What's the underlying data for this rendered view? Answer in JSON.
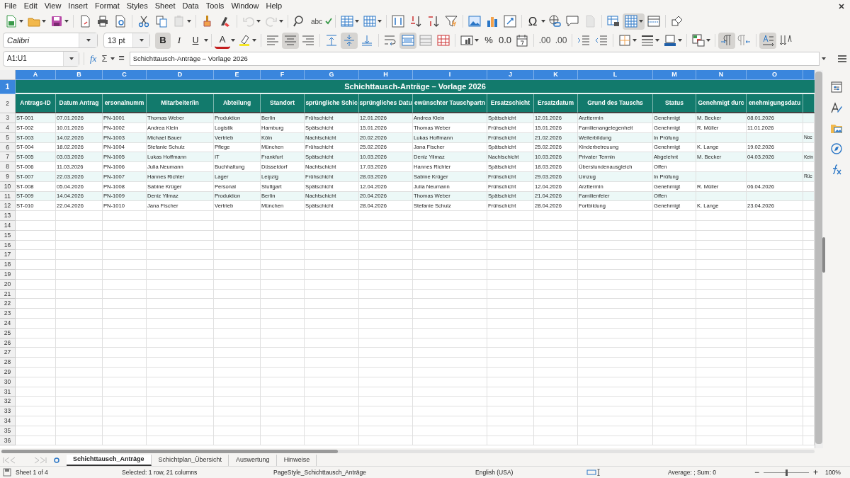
{
  "menu": [
    "File",
    "Edit",
    "View",
    "Insert",
    "Format",
    "Styles",
    "Sheet",
    "Data",
    "Tools",
    "Window",
    "Help"
  ],
  "standard_toolbar": [
    {
      "kind": "new"
    },
    {
      "kind": "open"
    },
    {
      "kind": "save"
    },
    {
      "kind": "sep"
    },
    {
      "kind": "pdf"
    },
    {
      "kind": "print"
    },
    {
      "kind": "preview"
    },
    {
      "kind": "sep"
    },
    {
      "kind": "cut"
    },
    {
      "kind": "copy"
    },
    {
      "kind": "paste",
      "disabled": true
    },
    {
      "kind": "sep"
    },
    {
      "kind": "brush"
    },
    {
      "kind": "clear"
    },
    {
      "kind": "sep"
    },
    {
      "kind": "undo",
      "disabled": true
    },
    {
      "kind": "redo",
      "disabled": true
    },
    {
      "kind": "sep"
    },
    {
      "kind": "find"
    },
    {
      "kind": "spell",
      "label": "abc"
    },
    {
      "kind": "sep"
    },
    {
      "kind": "rows"
    },
    {
      "kind": "cols"
    },
    {
      "kind": "sep"
    },
    {
      "kind": "sort"
    },
    {
      "kind": "sortasc"
    },
    {
      "kind": "sortdesc"
    },
    {
      "kind": "filter"
    },
    {
      "kind": "sep"
    },
    {
      "kind": "image"
    },
    {
      "kind": "chart"
    },
    {
      "kind": "pivot"
    },
    {
      "kind": "sep"
    },
    {
      "kind": "special",
      "label": "Ω"
    },
    {
      "kind": "link"
    },
    {
      "kind": "comment"
    },
    {
      "kind": "page",
      "disabled": true
    },
    {
      "kind": "sep"
    },
    {
      "kind": "printrange"
    },
    {
      "kind": "freeze",
      "pressed": true
    },
    {
      "kind": "split"
    },
    {
      "kind": "sep"
    },
    {
      "kind": "shapes"
    }
  ],
  "font_name": "Calibri",
  "font_size": "13 pt",
  "formatting_toolbar": [
    {
      "kind": "bold",
      "label": "B",
      "pressed": true
    },
    {
      "kind": "italic",
      "label": "I",
      "pressed": false
    },
    {
      "kind": "underline",
      "label": "U",
      "pressed": false
    },
    {
      "kind": "sep"
    },
    {
      "kind": "fontcolor",
      "label": "A",
      "pressed": false
    },
    {
      "kind": "highlight",
      "pressed": false
    },
    {
      "kind": "sep"
    },
    {
      "kind": "alignleft",
      "pressed": false
    },
    {
      "kind": "aligncenter",
      "pressed": true
    },
    {
      "kind": "alignright",
      "pressed": false
    },
    {
      "kind": "sep"
    },
    {
      "kind": "valigntop",
      "pressed": false
    },
    {
      "kind": "valignmid",
      "pressed": true
    },
    {
      "kind": "valignbottom",
      "pressed": false
    },
    {
      "kind": "sep"
    },
    {
      "kind": "wrap",
      "pressed": false
    },
    {
      "kind": "merge",
      "pressed": true
    },
    {
      "kind": "mergecells",
      "pressed": false
    },
    {
      "kind": "unmerge",
      "pressed": false
    },
    {
      "kind": "sep"
    },
    {
      "kind": "numformat",
      "pressed": false
    },
    {
      "kind": "percent",
      "label": "%",
      "pressed": false
    },
    {
      "kind": "decimal",
      "label": "0.0",
      "pressed": false
    },
    {
      "kind": "date",
      "pressed": false
    },
    {
      "kind": "sep"
    },
    {
      "kind": "adddec",
      "label": ".00",
      "pressed": false
    },
    {
      "kind": "deldec",
      "label": ".00",
      "pressed": false
    },
    {
      "kind": "sep"
    },
    {
      "kind": "indent",
      "pressed": false
    },
    {
      "kind": "outdent",
      "pressed": false
    },
    {
      "kind": "sep"
    },
    {
      "kind": "borders",
      "pressed": false
    },
    {
      "kind": "borderstyle",
      "pressed": false
    },
    {
      "kind": "bordercolor",
      "pressed": false
    },
    {
      "kind": "sep"
    },
    {
      "kind": "conditional",
      "pressed": false
    },
    {
      "kind": "sep"
    },
    {
      "kind": "ltr",
      "pressed": true
    },
    {
      "kind": "rtl",
      "pressed": false
    },
    {
      "kind": "sep"
    },
    {
      "kind": "textdir",
      "pressed": true
    },
    {
      "kind": "vertical",
      "pressed": false
    }
  ],
  "name_box": "A1:U1",
  "formula_buttons": [
    "fx",
    "Σ",
    "="
  ],
  "formula": "Schichttausch-Anträge – Vorlage 2026",
  "sheet": {
    "column_headers": [
      {
        "label": "A",
        "selected": true
      },
      {
        "label": "B",
        "selected": true
      },
      {
        "label": "C",
        "selected": true
      },
      {
        "label": "D",
        "selected": true
      },
      {
        "label": "E",
        "selected": true
      },
      {
        "label": "F",
        "selected": true
      },
      {
        "label": "G",
        "selected": true
      },
      {
        "label": "H",
        "selected": true
      },
      {
        "label": "I",
        "selected": true
      },
      {
        "label": "J",
        "selected": true
      },
      {
        "label": "K",
        "selected": true
      },
      {
        "label": "L",
        "selected": true
      },
      {
        "label": "M",
        "selected": true
      },
      {
        "label": "N",
        "selected": true
      },
      {
        "label": "O",
        "selected": true
      },
      {
        "selected": true
      }
    ],
    "row_headers": [
      {
        "label": "1",
        "selected": true
      },
      {
        "label": "2",
        "selected": false
      },
      {
        "label": "3",
        "selected": false
      },
      {
        "label": "4",
        "selected": false
      },
      {
        "label": "5",
        "selected": false
      },
      {
        "label": "6",
        "selected": false
      },
      {
        "label": "7",
        "selected": false
      },
      {
        "label": "8",
        "selected": false
      },
      {
        "label": "9",
        "selected": false
      },
      {
        "label": "10",
        "selected": false
      },
      {
        "label": "11",
        "selected": false
      },
      {
        "label": "12",
        "selected": false
      },
      {
        "label": "13",
        "selected": false
      },
      {
        "label": "14",
        "selected": false
      },
      {
        "label": "15",
        "selected": false
      },
      {
        "label": "16",
        "selected": false
      },
      {
        "label": "17",
        "selected": false
      },
      {
        "label": "18",
        "selected": false
      },
      {
        "label": "19",
        "selected": false
      },
      {
        "label": "20",
        "selected": false
      },
      {
        "label": "21",
        "selected": false
      },
      {
        "label": "22",
        "selected": false
      },
      {
        "label": "23",
        "selected": false
      },
      {
        "label": "24",
        "selected": false
      },
      {
        "label": "25",
        "selected": false
      },
      {
        "label": "26",
        "selected": false
      },
      {
        "label": "27",
        "selected": false
      },
      {
        "label": "28",
        "selected": false
      },
      {
        "label": "29",
        "selected": false
      },
      {
        "label": "30",
        "selected": false
      },
      {
        "label": "31",
        "selected": false
      },
      {
        "label": "32",
        "selected": false
      },
      {
        "label": "33",
        "selected": false
      },
      {
        "label": "34",
        "selected": false
      },
      {
        "label": "35",
        "selected": false
      },
      {
        "label": "36",
        "selected": false
      }
    ],
    "title": "Schichttausch-Anträge – Vorlage 2026",
    "headers": [
      "Antrags-ID",
      "Datum Antrag",
      "ersonalnumm",
      "Mitarbeiter/in",
      "Abteilung",
      "Standort",
      "sprüngliche Schic",
      "sprüngliches Datu",
      "ewünschter Tauschpartn",
      "Ersatzschicht",
      "Ersatzdatum",
      "Grund des Tauschs",
      "Status",
      "Genehmigt durc",
      "enehmigungsdatu"
    ],
    "rows": [
      [
        "ST-001",
        "07.01.2026",
        "PN-1001",
        "Thomas Weber",
        "Produktion",
        "Berlin",
        "Frühschicht",
        "12.01.2026",
        "Andrea Klein",
        "Spätschicht",
        "12.01.2026",
        "Arzttermin",
        "Genehmigt",
        "M. Becker",
        "08.01.2026"
      ],
      [
        "ST-002",
        "10.01.2026",
        "PN-1002",
        "Andrea Klein",
        "Logistik",
        "Hamburg",
        "Spätschicht",
        "15.01.2026",
        "Thomas Weber",
        "Frühschicht",
        "15.01.2026",
        "Familienangelegenheit",
        "Genehmigt",
        "R. Müller",
        "11.01.2026"
      ],
      [
        "ST-003",
        "14.02.2026",
        "PN-1003",
        "Michael Bauer",
        "Vertrieb",
        "Köln",
        "Nachtschicht",
        "20.02.2026",
        "Lukas Hoffmann",
        "Frühschicht",
        "21.02.2026",
        "Weiterbildung",
        "In Prüfung",
        null,
        null,
        "Noc"
      ],
      [
        "ST-004",
        "18.02.2026",
        "PN-1004",
        "Stefanie Schulz",
        "Pflege",
        "München",
        "Frühschicht",
        "25.02.2026",
        "Jana Fischer",
        "Spätschicht",
        "25.02.2026",
        "Kinderbetreuung",
        "Genehmigt",
        "K. Lange",
        "19.02.2026"
      ],
      [
        "ST-005",
        "03.03.2026",
        "PN-1005",
        "Lukas Hoffmann",
        "IT",
        "Frankfurt",
        "Spätschicht",
        "10.03.2026",
        "Deniz Yilmaz",
        "Nachtschicht",
        "10.03.2026",
        "Privater Termin",
        "Abgelehnt",
        "M. Becker",
        "04.03.2026",
        "Kein"
      ],
      [
        "ST-006",
        "11.03.2026",
        "PN-1006",
        "Julia Neumann",
        "Buchhaltung",
        "Düsseldorf",
        "Nachtschicht",
        "17.03.2026",
        "Hannes Richter",
        "Spätschicht",
        "18.03.2026",
        "Überstundenausgleich",
        "Offen"
      ],
      [
        "ST-007",
        "22.03.2026",
        "PN-1007",
        "Hannes Richter",
        "Lager",
        "Leipzig",
        "Frühschicht",
        "28.03.2026",
        "Sabine Krüger",
        "Frühschicht",
        "29.03.2026",
        "Umzug",
        "In Prüfung",
        null,
        null,
        "Rüc"
      ],
      [
        "ST-008",
        "05.04.2026",
        "PN-1008",
        "Sabine Krüger",
        "Personal",
        "Stuttgart",
        "Spätschicht",
        "12.04.2026",
        "Julia Neumann",
        "Frühschicht",
        "12.04.2026",
        "Arzttermin",
        "Genehmigt",
        "R. Müller",
        "06.04.2026"
      ],
      [
        "ST-009",
        "14.04.2026",
        "PN-1009",
        "Deniz Yilmaz",
        "Produktion",
        "Berlin",
        "Nachtschicht",
        "20.04.2026",
        "Thomas Weber",
        "Spätschicht",
        "21.04.2026",
        "Familienfeier",
        "Offen"
      ],
      [
        "ST-010",
        "22.04.2026",
        "PN-1010",
        "Jana Fischer",
        "Vertrieb",
        "München",
        "Spätschicht",
        "28.04.2026",
        "Stefanie Schulz",
        "Frühschicht",
        "28.04.2026",
        "Fortbildung",
        "Genehmigt",
        "K. Lange",
        "23.04.2026"
      ]
    ]
  },
  "sheet_tabs": [
    {
      "label": "Schichttausch_Anträge",
      "selected": true
    },
    {
      "label": "Schichtplan_Übersicht",
      "selected": false
    },
    {
      "label": "Auswertung",
      "selected": false
    },
    {
      "label": "Hinweise",
      "selected": false
    }
  ],
  "status_bar": {
    "sheet": "Sheet 1 of 4",
    "selection": "Selected: 1 row, 21 columns",
    "page_style": "PageStyle_Schichttausch_Anträge",
    "language": "English (USA)",
    "sum": "Average: ; Sum: 0",
    "zoom_out": "−",
    "zoom_slider": {
      "level": 0.5
    },
    "zoom_in": "+",
    "zoom": "100%"
  }
}
